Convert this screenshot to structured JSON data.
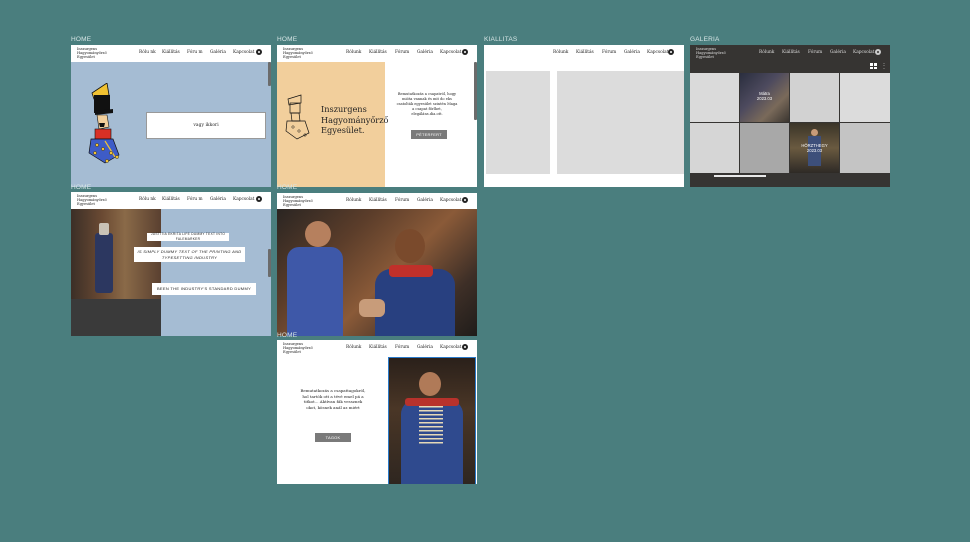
{
  "frames": {
    "home1": {
      "label": "HOME",
      "overlay_text": "vagy ikkori"
    },
    "home2": {
      "label": "HOME",
      "brand_title": "Inszurgens Hagyományőrző Egyesület.",
      "body_text": "Bemutatkozás a csapatról, hogy mióta vannak és mit do eks csatolták egyesület szintén Maga a csapat főrlhet, elegáláns.dia.ott.",
      "button_label": "PÉTERFERT"
    },
    "kiallitas": {
      "label": "KIALLITAS"
    },
    "galeria": {
      "label": "GALERIA",
      "tile1_line1": "Mátra",
      "tile1_line2": "2023.03",
      "tile2_line1": "HÖRZTHEGY",
      "tile2_line2": "2023.03"
    },
    "home3": {
      "label": "HOME",
      "line1": "JUSTITIA EKRITA LIFE DUMMY TEXT INTO FALEMARKER",
      "line2": "IS SIMPLY DUMMY TEXT OF THE PRINTING AND TYPESETTING INDUSTRY",
      "line3": "BEEN THE INDUSTRY'S STANDARD DUMMY"
    },
    "home4": {
      "label": "HOME"
    },
    "home5": {
      "label": "HOME",
      "text": "Bemutatkozás a csapattagokról, hol tartók ott a tévé emel pá a titkot... Aktívan fák vessznek okot, kösnek anál az miért",
      "button_label": "TAGOK"
    }
  },
  "nav": {
    "logo": "Inszurgens\nHagyományőrző\nEgyesület",
    "links": [
      "Rólunk",
      "Kiállítás",
      "Fórum",
      "Galéria",
      "Kapcsolat"
    ],
    "links_home1": [
      "Rólu nk",
      "Kiállítás",
      "Fóru m",
      "Galéria",
      "Kapcsolat"
    ]
  },
  "colors": {
    "background": "#4a7e7e",
    "light_blue": "#a5bcd3",
    "peach": "#f2cf9c",
    "dark_nav": "#363432"
  }
}
